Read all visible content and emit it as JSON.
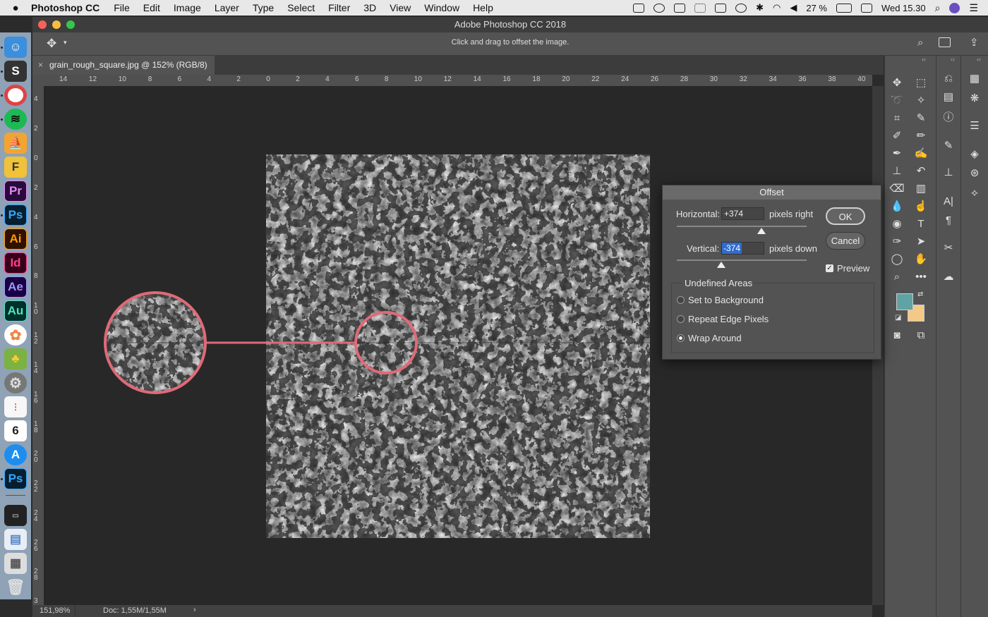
{
  "menubar": {
    "app_name": "Photoshop CC",
    "items": [
      "File",
      "Edit",
      "Image",
      "Layer",
      "Type",
      "Select",
      "Filter",
      "3D",
      "View",
      "Window",
      "Help"
    ],
    "battery": "27 %",
    "clock": "Wed 15.30"
  },
  "window": {
    "title": "Adobe Photoshop CC 2018"
  },
  "options_bar": {
    "hint": "Click and drag to offset the image."
  },
  "document": {
    "tab_close": "×",
    "tab_title": "grain_rough_square.jpg @ 152% (RGB/8)"
  },
  "rulers": {
    "top": [
      "14",
      "12",
      "10",
      "8",
      "6",
      "4",
      "2",
      "0",
      "2",
      "4",
      "6",
      "8",
      "10",
      "12",
      "14",
      "16",
      "18",
      "20",
      "22",
      "24",
      "26",
      "28",
      "30",
      "32",
      "34",
      "36",
      "38",
      "40"
    ],
    "left": [
      "4",
      "2",
      "0",
      "2",
      "4",
      "6",
      "8",
      "10",
      "12",
      "14",
      "16",
      "18",
      "20",
      "22",
      "24",
      "26",
      "28",
      "3"
    ]
  },
  "status": {
    "zoom": "151,98%",
    "doc_size": "Doc: 1,55M/1,55M",
    "arrow": "›"
  },
  "dock": {
    "apps": [
      "Finder",
      "Sublime",
      "Chrome",
      "Spotify",
      "Transmit",
      "Fontself",
      "Pr",
      "Ps",
      "Ai",
      "Id",
      "Ae",
      "Au",
      "Photos",
      "Pineapple",
      "System Preferences",
      "Reminders",
      "Calendar",
      "App Store",
      "Ps",
      "Screen",
      "Preview",
      "Preview 2",
      "Trash"
    ],
    "calendar_day": "6"
  },
  "offset_dialog": {
    "title": "Offset",
    "horizontal_label": "Horizontal:",
    "horizontal_value": "+374",
    "horizontal_unit": "pixels right",
    "vertical_label": "Vertical:",
    "vertical_value": "-374",
    "vertical_unit": "pixels down",
    "ok_label": "OK",
    "cancel_label": "Cancel",
    "preview_label": "Preview",
    "preview_checked": true,
    "undefined_areas_label": "Undefined Areas",
    "options": [
      "Set to Background",
      "Repeat Edge Pixels",
      "Wrap Around"
    ],
    "selected_option": "Wrap Around"
  },
  "colors": {
    "foreground": "#5fa3a4",
    "background": "#f4c987",
    "highlight_circle": "#e06a78"
  }
}
